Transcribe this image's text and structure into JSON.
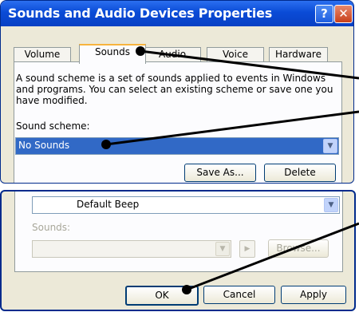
{
  "window": {
    "title": "Sounds and Audio Devices Properties",
    "help_glyph": "?",
    "close_glyph": "✕"
  },
  "tabs": [
    {
      "label": "Volume"
    },
    {
      "label": "Sounds"
    },
    {
      "label": "Audio"
    },
    {
      "label": "Voice"
    },
    {
      "label": "Hardware"
    }
  ],
  "sounds_tab": {
    "description": "A sound scheme is a set of sounds applied to events in Windows and programs. You can select an existing scheme or save one you have modified.",
    "scheme_label": "Sound scheme:",
    "scheme_value": "No Sounds",
    "save_as_label": "Save As...",
    "delete_label": "Delete",
    "program_event_value": "Default Beep",
    "sounds_label": "Sounds:",
    "sounds_value": "",
    "browse_label": "Browse..."
  },
  "footer": {
    "ok_label": "OK",
    "cancel_label": "Cancel",
    "apply_label": "Apply"
  },
  "colors": {
    "titlebar": "#0a4bd6",
    "selection": "#3169c6",
    "active_tab_accent": "#f7b43e"
  }
}
